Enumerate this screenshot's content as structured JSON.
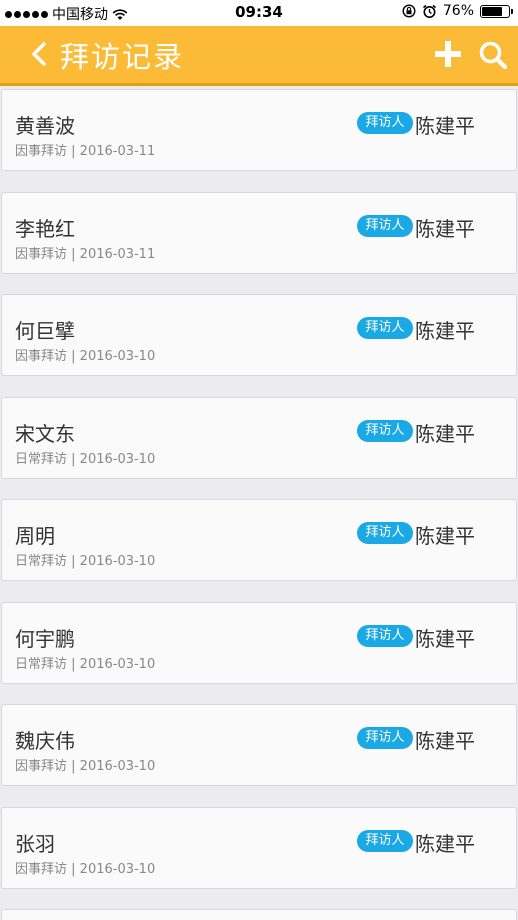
{
  "status_bar": {
    "carrier": "中国移动",
    "time": "09:34",
    "battery": "76%",
    "battery_level": 0.76
  },
  "header": {
    "title": "拜访记录",
    "icons": [
      "chevron-left-icon",
      "plus-icon",
      "search-icon"
    ],
    "background": "#FBBB36"
  },
  "badge_color": "#1BA9E6",
  "records": [
    {
      "name": "黄善波",
      "type": "因事拜访",
      "date": "2016-03-11",
      "badge": "拜访人",
      "visitor": "陈建平"
    },
    {
      "name": "李艳红",
      "type": "因事拜访",
      "date": "2016-03-11",
      "badge": "拜访人",
      "visitor": "陈建平"
    },
    {
      "name": "何巨擘",
      "type": "因事拜访",
      "date": "2016-03-10",
      "badge": "拜访人",
      "visitor": "陈建平"
    },
    {
      "name": "宋文东",
      "type": "日常拜访",
      "date": "2016-03-10",
      "badge": "拜访人",
      "visitor": "陈建平"
    },
    {
      "name": "周明",
      "type": "日常拜访",
      "date": "2016-03-10",
      "badge": "拜访人",
      "visitor": "陈建平"
    },
    {
      "name": "何宇鹏",
      "type": "日常拜访",
      "date": "2016-03-10",
      "badge": "拜访人",
      "visitor": "陈建平"
    },
    {
      "name": "魏庆伟",
      "type": "因事拜访",
      "date": "2016-03-10",
      "badge": "拜访人",
      "visitor": "陈建平"
    },
    {
      "name": "张羽",
      "type": "因事拜访",
      "date": "2016-03-10",
      "badge": "拜访人",
      "visitor": "陈建平"
    }
  ]
}
